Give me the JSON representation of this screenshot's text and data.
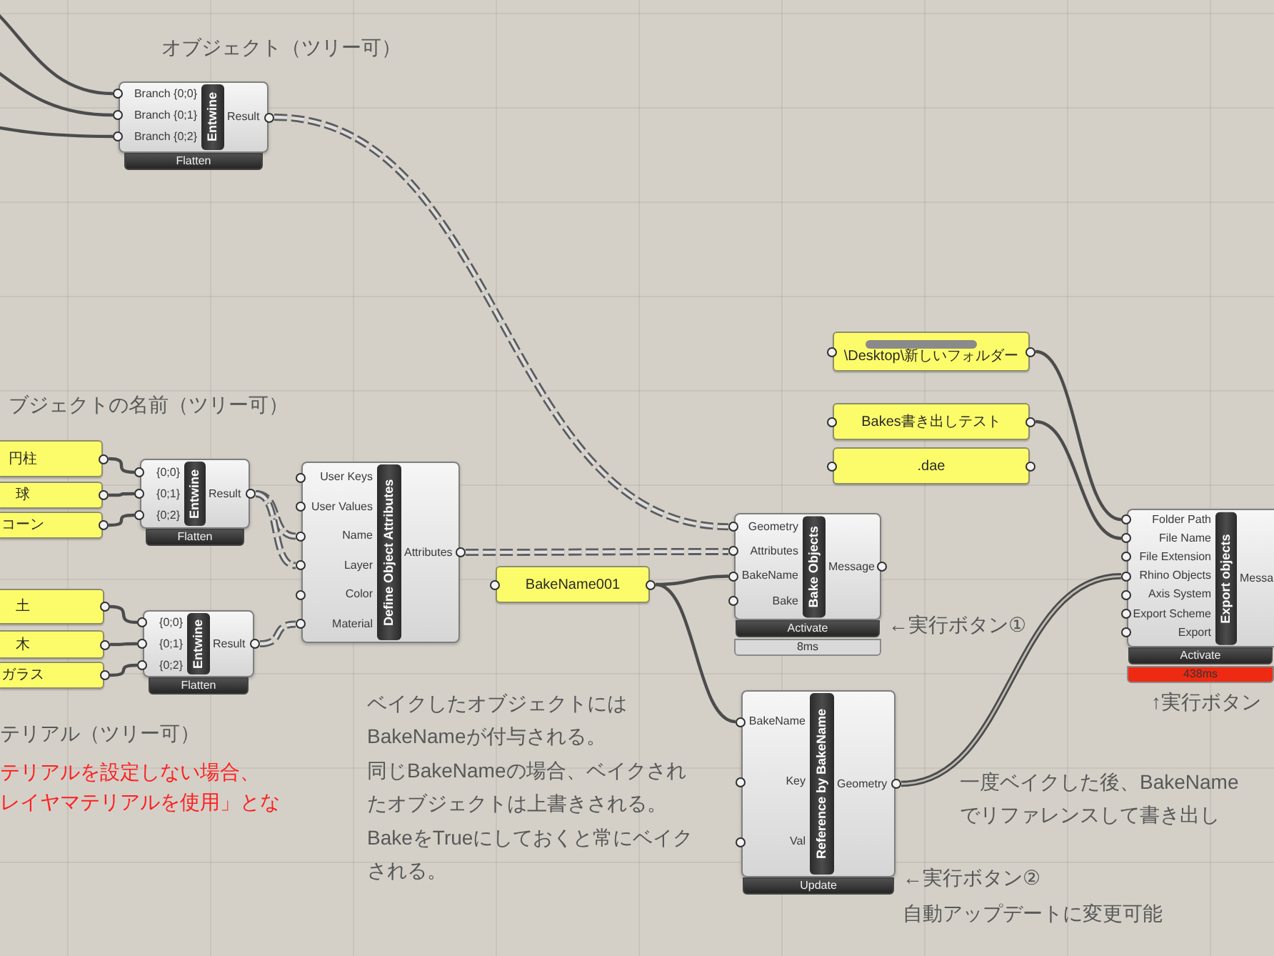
{
  "canvas": {
    "notes": [
      {
        "kind": "note",
        "lines": [
          "オブジェクト（ツリー可）"
        ]
      },
      {
        "kind": "note",
        "lines": [
          "ブジェクトの名前（ツリー可）"
        ]
      },
      {
        "kind": "note",
        "lines": [
          "テリアル（ツリー可）"
        ]
      },
      {
        "kind": "warning",
        "lines": [
          "テリアルを設定しない場合、",
          "レイヤマテリアルを使用」とな"
        ]
      },
      {
        "kind": "note",
        "lines": [
          "ベイクしたオブジェクトには",
          "BakeNameが付与される。",
          "同じBakeNameの場合、ベイクされ",
          "たオブジェクトは上書きされる。",
          "BakeをTrueにしておくと常にベイク",
          "される。"
        ]
      },
      {
        "kind": "note",
        "lines": [
          "←実行ボタン①"
        ]
      },
      {
        "kind": "note",
        "lines": [
          "↑実行ボタン"
        ]
      },
      {
        "kind": "note",
        "lines": [
          "一度ベイクした後、BakeName",
          "でリファレンスして書き出し"
        ]
      },
      {
        "kind": "note",
        "lines": [
          "←実行ボタン②",
          "自動アップデートに変更可能"
        ]
      }
    ],
    "panels": [
      {
        "text": "円柱"
      },
      {
        "text": "球"
      },
      {
        "text": "コーン"
      },
      {
        "text": "土"
      },
      {
        "text": "木"
      },
      {
        "text": "ガラス"
      },
      {
        "text": "BakeName001"
      },
      {
        "text": "\\Desktop\\新しいフォルダー"
      },
      {
        "text": "Bakes書き出しテスト"
      },
      {
        "text": ".dae"
      }
    ],
    "components": [
      {
        "title": "Entwine",
        "inputs": [
          "Branch {0;0}",
          "Branch {0;1}",
          "Branch {0;2}"
        ],
        "outputs": [
          "Result"
        ],
        "footer": [
          {
            "kind": "option",
            "text": "Flatten"
          }
        ]
      },
      {
        "title": "Entwine",
        "inputs": [
          "{0;0}",
          "{0;1}",
          "{0;2}"
        ],
        "outputs": [
          "Result"
        ],
        "footer": [
          {
            "kind": "option",
            "text": "Flatten"
          }
        ]
      },
      {
        "title": "Entwine",
        "inputs": [
          "{0;0}",
          "{0;1}",
          "{0;2}"
        ],
        "outputs": [
          "Result"
        ],
        "footer": [
          {
            "kind": "option",
            "text": "Flatten"
          }
        ]
      },
      {
        "title": "Define Object Attributes",
        "inputs": [
          "User Keys",
          "User Values",
          "Name",
          "Layer",
          "Color",
          "Material"
        ],
        "outputs": [
          "Attributes"
        ]
      },
      {
        "title": "Bake Objects",
        "inputs": [
          "Geometry",
          "Attributes",
          "BakeName",
          "Bake"
        ],
        "outputs": [
          "Message"
        ],
        "footer": [
          {
            "kind": "option",
            "text": "Activate"
          },
          {
            "kind": "timer",
            "text": "8ms",
            "color": "#d9d9d9"
          }
        ]
      },
      {
        "title": "Reference by BakeName",
        "inputs": [
          "BakeName",
          "Key",
          "Val"
        ],
        "outputs": [
          "Geometry"
        ],
        "footer": [
          {
            "kind": "option",
            "text": "Update"
          }
        ]
      },
      {
        "title": "Export objects",
        "inputs": [
          "Folder Path",
          "File Name",
          "File Extension",
          "Rhino Objects",
          "Axis System",
          "Export Scheme",
          "Export"
        ],
        "outputs": [
          "Messa"
        ],
        "footer": [
          {
            "kind": "option",
            "text": "Activate"
          },
          {
            "kind": "timer",
            "text": "438ms",
            "color": "#ee2a12"
          }
        ]
      }
    ]
  }
}
